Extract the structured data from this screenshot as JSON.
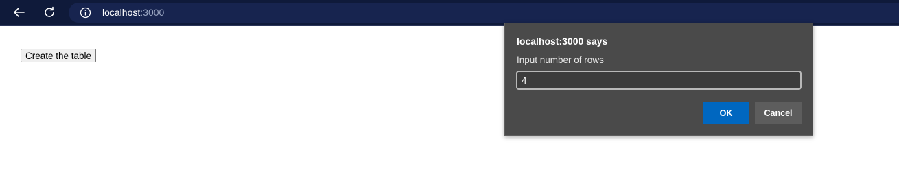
{
  "browser": {
    "back_icon": "arrow-left-icon",
    "reload_icon": "reload-icon",
    "site_info_icon": "info-icon",
    "url_host": "localhost",
    "url_port": ":3000",
    "colors": {
      "toolbar": "#0f1a3a",
      "omnibox": "#17244f"
    }
  },
  "page": {
    "create_button_label": "Create the table"
  },
  "dialog": {
    "title": "localhost:3000 says",
    "message": "Input number of rows",
    "input_value": "4",
    "ok_label": "OK",
    "cancel_label": "Cancel",
    "colors": {
      "background": "#4a4a4a",
      "ok_button": "#0067c0",
      "cancel_button": "#5d5d5d"
    }
  }
}
